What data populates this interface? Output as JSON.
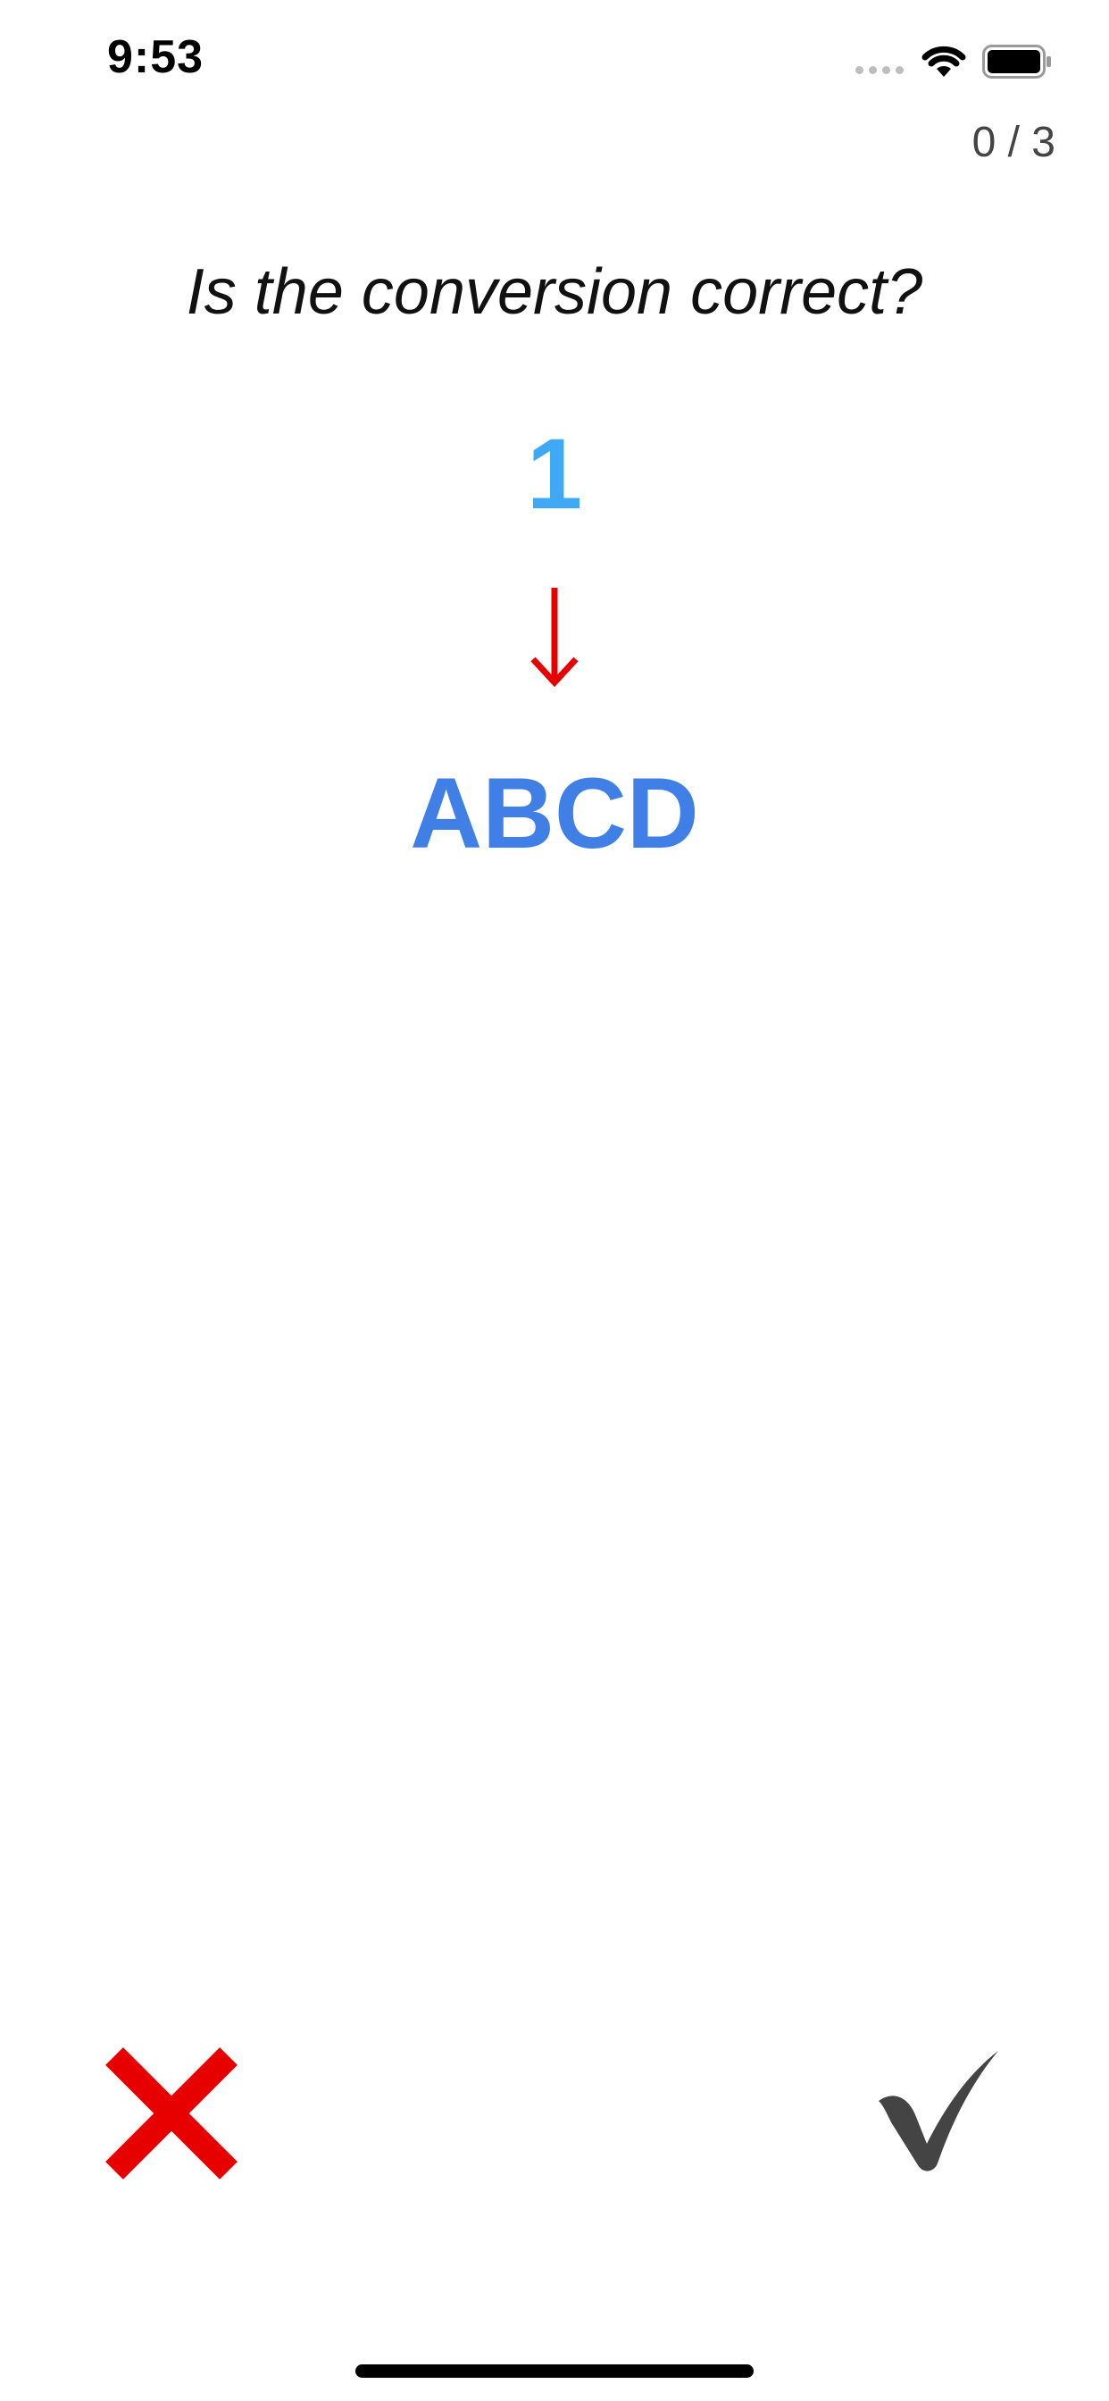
{
  "status_bar": {
    "time": "9:53",
    "signal_icon": "cellular-signal-icon",
    "wifi_icon": "wifi-icon",
    "battery_icon": "battery-icon"
  },
  "progress": {
    "text": "0 / 3"
  },
  "quiz": {
    "question": "Is the conversion correct?",
    "source_value": "1",
    "target_value": "ABCD",
    "arrow_icon": "arrow-down-icon"
  },
  "actions": {
    "wrong_icon": "cross-icon",
    "correct_icon": "checkmark-icon"
  },
  "colors": {
    "source": "#3fa9f5",
    "target": "#3f7fe6",
    "arrow": "#e60000",
    "wrong": "#e60000",
    "correct": "#444444"
  }
}
